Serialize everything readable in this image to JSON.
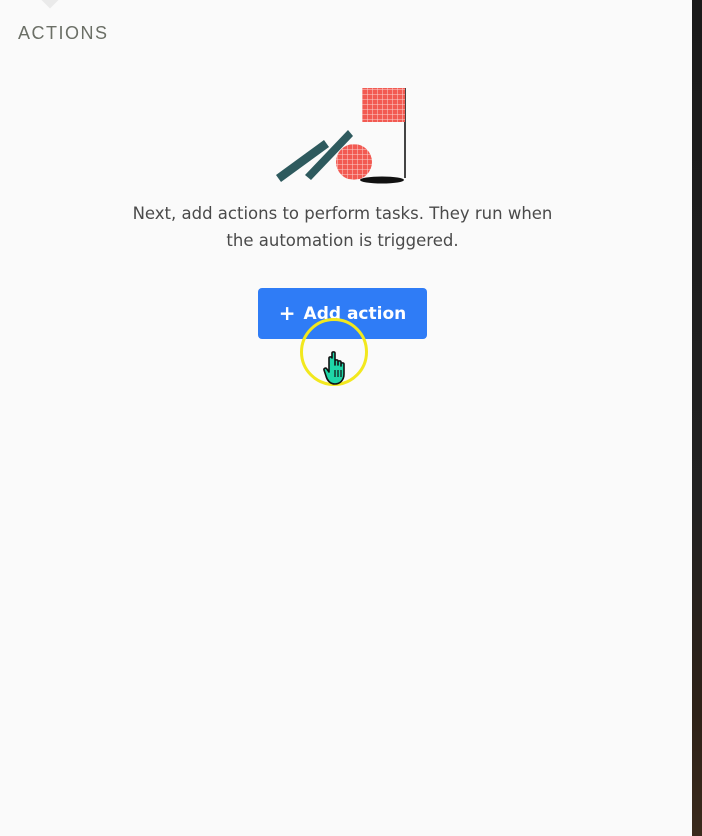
{
  "section": {
    "title": "ACTIONS"
  },
  "empty_state": {
    "illustration": "flag-and-dominoes-illustration",
    "description": "Next, add actions to perform tasks. They run when the automation is triggered."
  },
  "add_action_button": {
    "icon": "plus-icon",
    "label": "Add action"
  },
  "colors": {
    "accent": "#2f7cf6",
    "illustration_red": "#f25a52",
    "illustration_teal": "#2e5a5e",
    "cursor_ring": "#f2e81e",
    "cursor_hand": "#1fd6a8"
  }
}
